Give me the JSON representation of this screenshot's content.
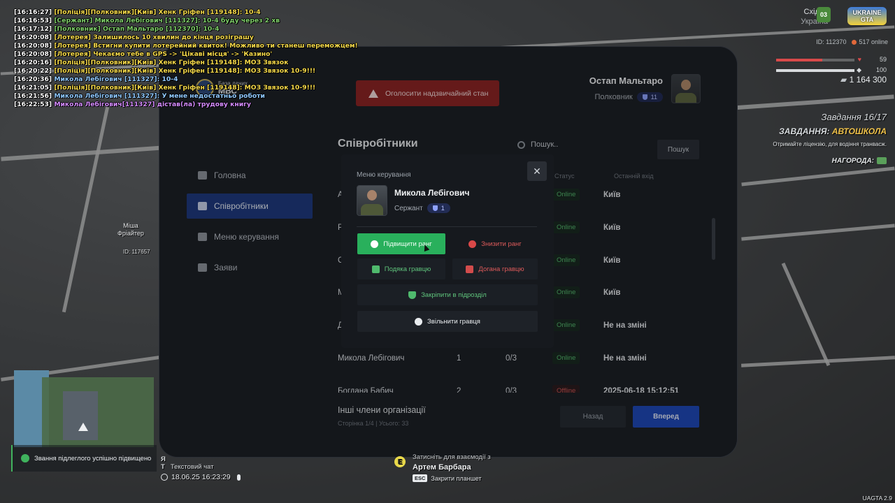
{
  "chat": [
    {
      "time": "[16:16:27]",
      "text": "[Поліція][Полковник][Київ] Хенк Гріфен [119148]: 10-4",
      "color": "#f5d94a"
    },
    {
      "time": "[16:16:53]",
      "text": "[Сержант] Микола Лебігович [111327]: 10-4 буду через 2 хв",
      "color": "#7fcf6a"
    },
    {
      "time": "[16:17:12]",
      "text": "[Полковник] Остап Мальтаро [112370]: 10-4",
      "color": "#7fcf6a"
    },
    {
      "time": "[16:20:08]",
      "text": "[Лотерея] Залишилось 10 хвилин до кінця розіграшу",
      "color": "#f5d94a"
    },
    {
      "time": "[16:20:08]",
      "text": "[Лотерея] Встигни купити лотерейний квиток! Можливо ти станеш переможцем!",
      "color": "#f5d94a"
    },
    {
      "time": "[16:20:08]",
      "text": "[Лотерея] Чекаємо тебе в GPS -> 'Цікаві місця' -> 'Казино'",
      "color": "#f5d94a"
    },
    {
      "time": "[16:20:16]",
      "text": "[Поліція][Полковник][Київ] Хенк Гріфен [119148]: МОЗ Звязок",
      "color": "#f5d94a"
    },
    {
      "time": "[16:20:22]",
      "text": "[Поліція][Полковник][Київ] Хенк Гріфен [119148]: МОЗ Звязок 10-9!!!",
      "color": "#f5d94a"
    },
    {
      "time": "[16:20:36]",
      "text": "Микола Лебігович [111327]: 10-4",
      "color": "#8fc8ff"
    },
    {
      "time": "[16:21:05]",
      "text": "[Поліція][Полковник][Київ] Хенк Гріфен [119148]: МОЗ Звязок 10-9!!!",
      "color": "#f5d94a"
    },
    {
      "time": "[16:21:56]",
      "text": "Микола Лебігович [111327]: У мене недостатньо роботи",
      "color": "#8fc8ff"
    },
    {
      "time": "[16:22:53]",
      "text": "Микола Лебігович[111327] дістав(ла) трудову книгу",
      "color": "#d58cff"
    }
  ],
  "hud": {
    "region_line1": "Східна",
    "region_line2": "Україна",
    "region_badge": "03",
    "logo_text": "UKRAINE GTA",
    "player_id": "ID: 112370",
    "online": "517 online",
    "health_value": "59",
    "health_level": 0.59,
    "armor_value": "100",
    "armor_level": 1.0,
    "money": "1 164 300",
    "task_progress": "Завдання 16/17",
    "task_prefix": "ЗАВДАННЯ:",
    "task_name": "АВТОШКОЛА",
    "task_description": "Отримайте ліцензію, для водіння транвасж.",
    "reward_label": "НАГОРОДА:"
  },
  "world": {
    "npc_name_line1": "Міша",
    "npc_name_line2": "Фріайтер",
    "npc_id": "ID: 117657"
  },
  "tablet": {
    "db_label_small": "База даних",
    "db_label_big": "МВС",
    "emergency_button": "Оголосити надзвичайний стан",
    "user_name": "Остап Мальтаро",
    "user_rank": "Полковник",
    "user_rank_level": "11",
    "sidebar": [
      {
        "label": "Головна",
        "active": false
      },
      {
        "label": "Співробітники",
        "active": true
      },
      {
        "label": "Меню керування",
        "active": false
      },
      {
        "label": "Заяви",
        "active": false
      }
    ],
    "section_title": "Співробітники",
    "search_placeholder": "Пошук..",
    "search_button": "Пошук",
    "columns": {
      "status": "Статус",
      "last_login": "Останній вхід"
    },
    "rows": [
      {
        "initial": "А",
        "status": "Online",
        "location": "Київ"
      },
      {
        "initial": "Р",
        "status": "Online",
        "location": "Київ"
      },
      {
        "initial": "С",
        "status": "Online",
        "location": "Київ"
      },
      {
        "initial": "М",
        "status": "Online",
        "location": "Київ"
      },
      {
        "initial": "Д",
        "status": "Online",
        "location": "Не на зміні"
      },
      {
        "name": "Микола Лебігович",
        "rank": "1",
        "tasks": "0/3",
        "status": "Online",
        "location": "Не на зміні"
      },
      {
        "name": "Богдана Бабич",
        "rank": "2",
        "tasks": "0/3",
        "status": "Offline",
        "location": "2025-06-18 15:12:51"
      }
    ],
    "other_members": "Інші члени організації",
    "pager": "Сторінка 1/4 | Усього: 33",
    "back_button": "Назад",
    "next_button": "Вперед"
  },
  "modal": {
    "title": "Меню керування",
    "close": "✕",
    "name": "Микола Лебігович",
    "rank": "Сержант",
    "rank_level": "1",
    "promote": "Підвищити ранг",
    "demote": "Знизити ранг",
    "thanks": "Подяка гравцю",
    "reprimand": "Догана гравцю",
    "assign": "Закріпити в підрозділ",
    "fire": "Звільнити гравця"
  },
  "bottom": {
    "notification": "Звання підлеглого успішно підвищено",
    "chat_key_1": "Я",
    "chat_key_2": "T",
    "chat_label": "Текстовий чат",
    "datetime": "18.06.25 16:23:29",
    "interact_line1": "Затисніть для взаємодії з",
    "interact_key": "E",
    "interact_name": "Артем Барбара",
    "esc_key": "ESC",
    "esc_label": "Закрити планшет",
    "version": "UAGTA 2.9"
  }
}
